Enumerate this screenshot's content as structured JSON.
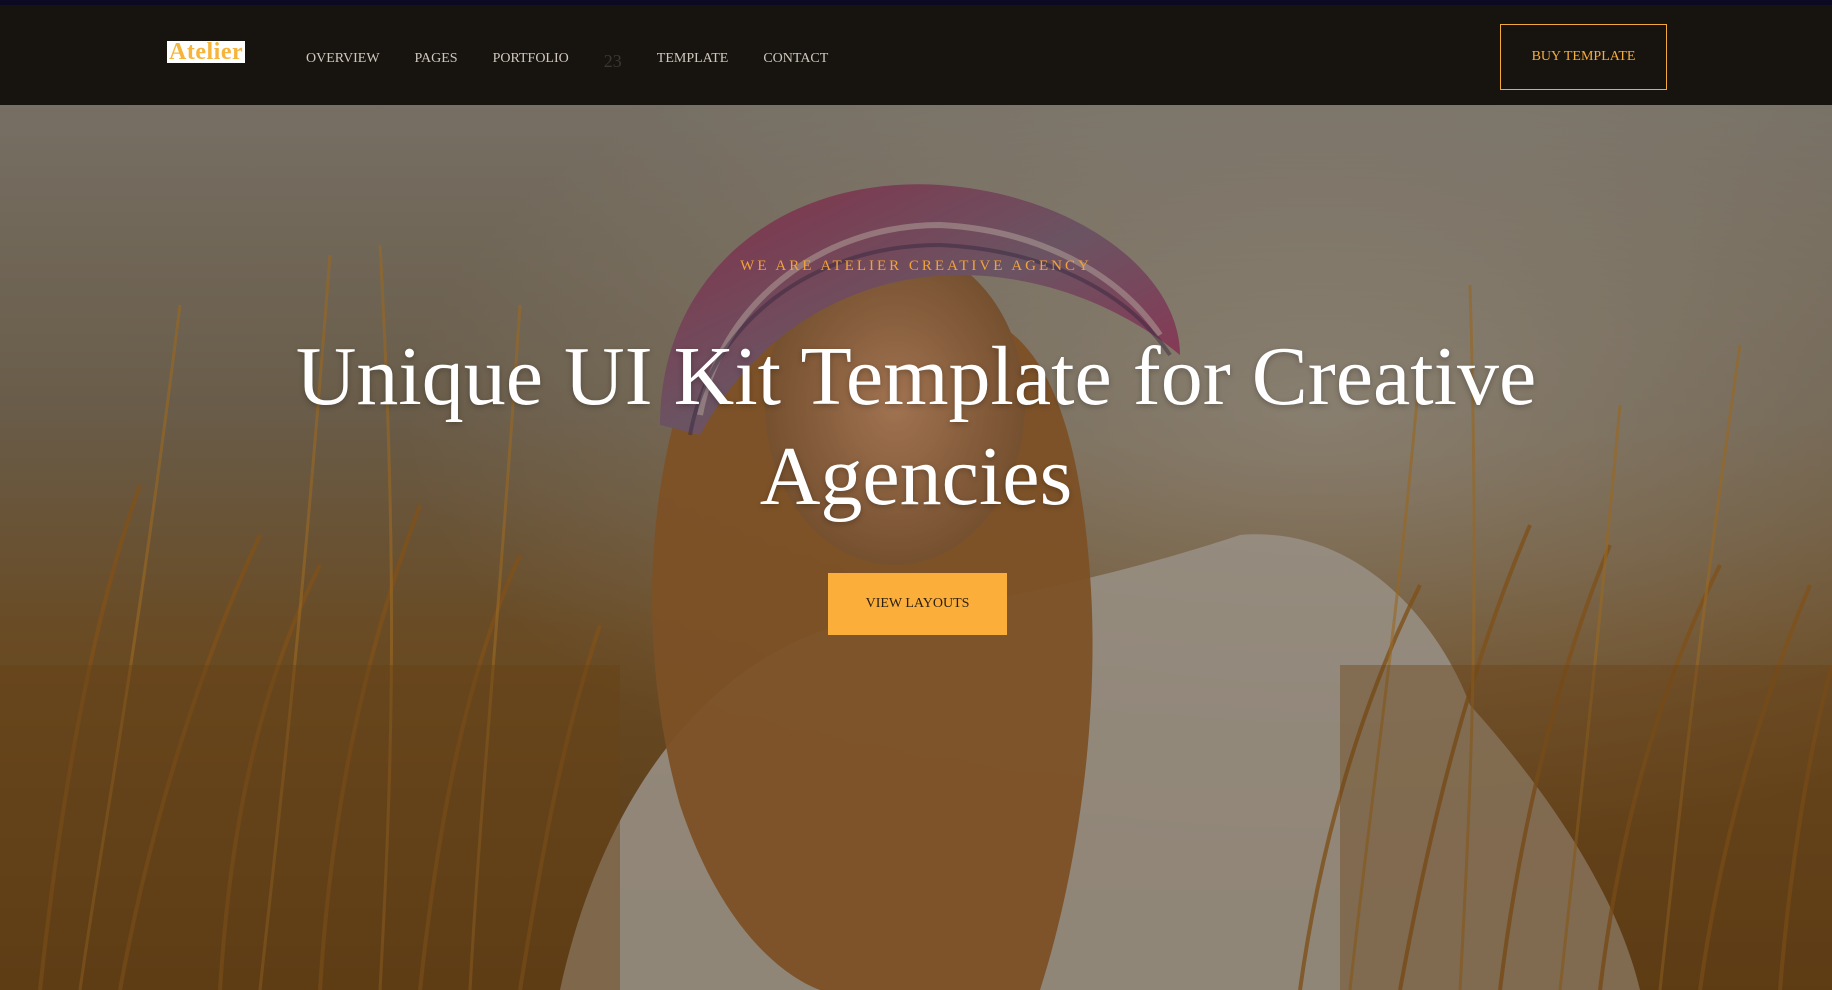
{
  "brand": {
    "logo_text": "Atelier"
  },
  "nav": {
    "items": [
      {
        "label": "OVERVIEW"
      },
      {
        "label": "PAGES"
      },
      {
        "label": "PORTFOLIO"
      },
      {
        "label": "23"
      },
      {
        "label": "TEMPLATE"
      },
      {
        "label": "CONTACT"
      }
    ],
    "buy_label": "BUY TEMPLATE"
  },
  "hero": {
    "eyebrow": "WE ARE ATELIER CREATIVE AGENCY",
    "headline": "Unique UI Kit Template for Creative Agencies",
    "cta_label": "VIEW LAYOUTS"
  },
  "colors": {
    "accent": "#fcae3a",
    "navbar_bg": "#17130f",
    "heading": "#ffffff",
    "nav_text": "#cfc8bd"
  }
}
